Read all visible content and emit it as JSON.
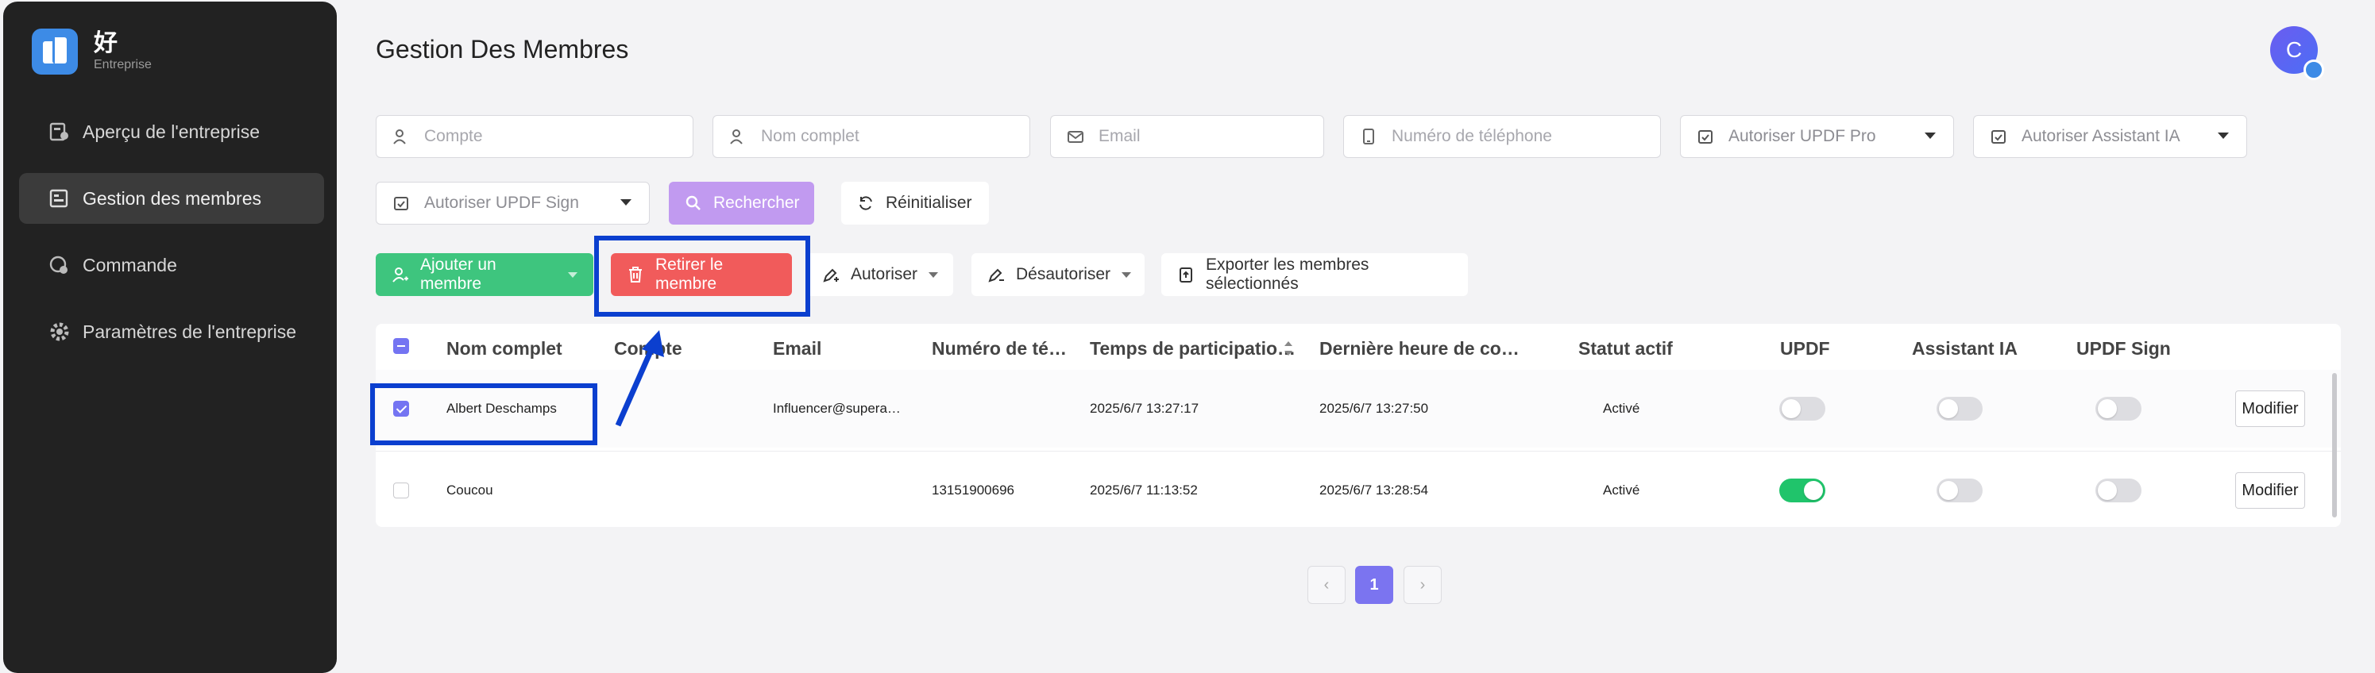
{
  "brand": {
    "name": "好",
    "subtitle": "Entreprise"
  },
  "sidebar": {
    "items": [
      {
        "label": "Aperçu de l'entreprise",
        "icon": "overview-icon",
        "active": false
      },
      {
        "label": "Gestion des membres",
        "icon": "members-icon",
        "active": true
      },
      {
        "label": "Commande",
        "icon": "order-icon",
        "active": false
      },
      {
        "label": "Paramètres de l'entreprise",
        "icon": "settings-gear-icon",
        "active": false
      }
    ]
  },
  "header": {
    "title": "Gestion Des Membres",
    "avatar_letter": "C"
  },
  "filters": {
    "account_placeholder": "Compte",
    "fullname_placeholder": "Nom complet",
    "email_placeholder": "Email",
    "phone_placeholder": "Numéro de téléphone",
    "updf_pro_select": "Autoriser UPDF Pro",
    "ai_select": "Autoriser Assistant IA",
    "updf_sign_select": "Autoriser UPDF Sign",
    "search_label": "Rechercher",
    "reset_label": "Réinitialiser"
  },
  "actions": {
    "add_member": "Ajouter un membre",
    "remove_member": "Retirer le membre",
    "authorize": "Autoriser",
    "deauthorize": "Désautoriser",
    "export": "Exporter les membres sélectionnés"
  },
  "table": {
    "headers": [
      "Nom complet",
      "Compte",
      "Email",
      "Numéro de té…",
      "Temps de participatio…",
      "Dernière heure de co…",
      "Statut actif",
      "UPDF",
      "Assistant IA",
      "UPDF Sign"
    ],
    "rows": [
      {
        "checked": true,
        "name": "Albert Deschamps",
        "account": "",
        "email": "Influencer@supera…",
        "phone": "",
        "joined": "2025/6/7 13:27:17",
        "last_login": "2025/6/7 13:27:50",
        "status": "Activé",
        "updf": false,
        "ai": false,
        "sign": false,
        "edit_label": "Modifier"
      },
      {
        "checked": false,
        "name": "Coucou",
        "account": "",
        "email": "",
        "phone": "13151900696",
        "joined": "2025/6/7 11:13:52",
        "last_login": "2025/6/7 13:28:54",
        "status": "Activé",
        "updf": true,
        "ai": false,
        "sign": false,
        "edit_label": "Modifier"
      }
    ]
  },
  "pagination": {
    "current_page": "1",
    "prev": "‹",
    "next": "›"
  },
  "colors": {
    "accent": "#7474f2",
    "add": "#3ec57e",
    "remove": "#f15b5b",
    "search": "#c19af0",
    "annotation": "#0b3fcf"
  }
}
